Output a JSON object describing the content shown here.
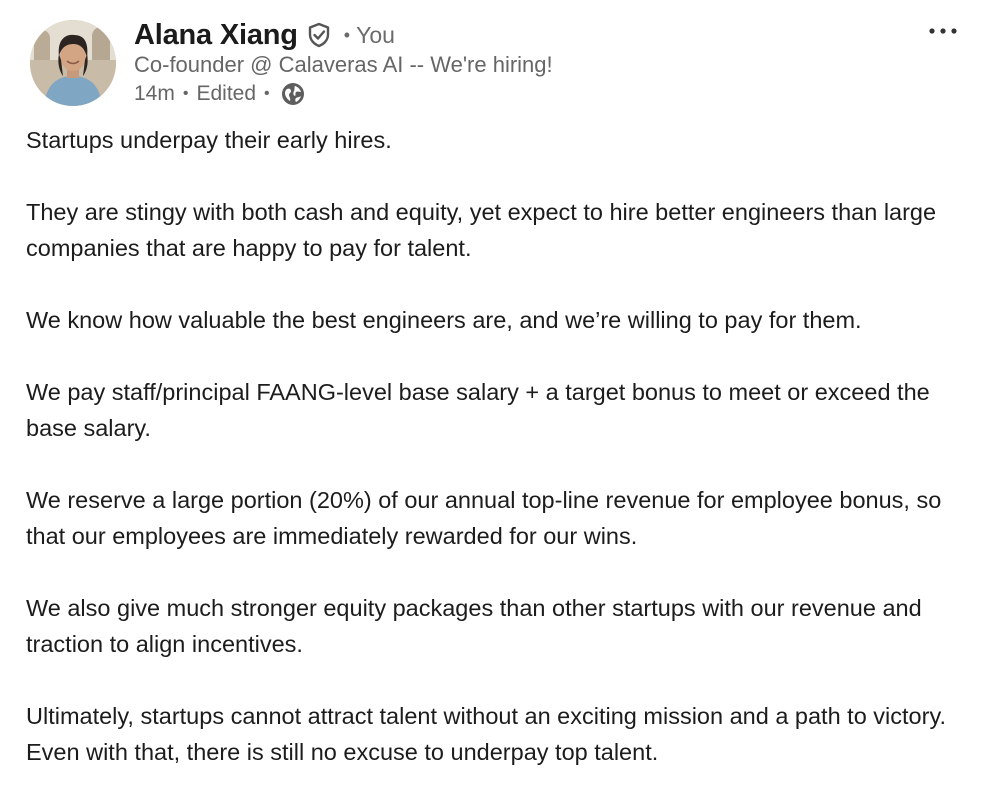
{
  "author": {
    "name": "Alana Xiang",
    "relation": "You",
    "headline": "Co-founder @ Calaveras AI -- We're hiring!",
    "avatar_icon": "profile-photo",
    "verified_icon": "verified-shield-icon"
  },
  "meta": {
    "time": "14m",
    "edited": "Edited",
    "visibility_icon": "globe-icon"
  },
  "actions": {
    "more_icon": "more-options-icon"
  },
  "post": {
    "paragraphs": [
      "Startups underpay their early hires.",
      "They are stingy with both cash and equity, yet expect to hire better engineers than large companies that are happy to pay for talent.",
      "We know how valuable the best engineers are, and we’re willing to pay for them.",
      "We pay staff/principal FAANG-level base salary + a target bonus to meet or exceed the base salary.",
      "We reserve a large portion (20%) of our annual top-line revenue for employee bonus, so that our employees are immediately rewarded for our wins.",
      "We also give much stronger equity packages than other startups with our revenue and traction to align incentives.",
      "Ultimately, startups cannot attract talent without an exciting mission and a path to victory. Even with that, there is still no excuse to underpay top talent."
    ]
  },
  "colors": {
    "text": "#1c1c1c",
    "secondary": "#666666",
    "background": "#ffffff"
  }
}
